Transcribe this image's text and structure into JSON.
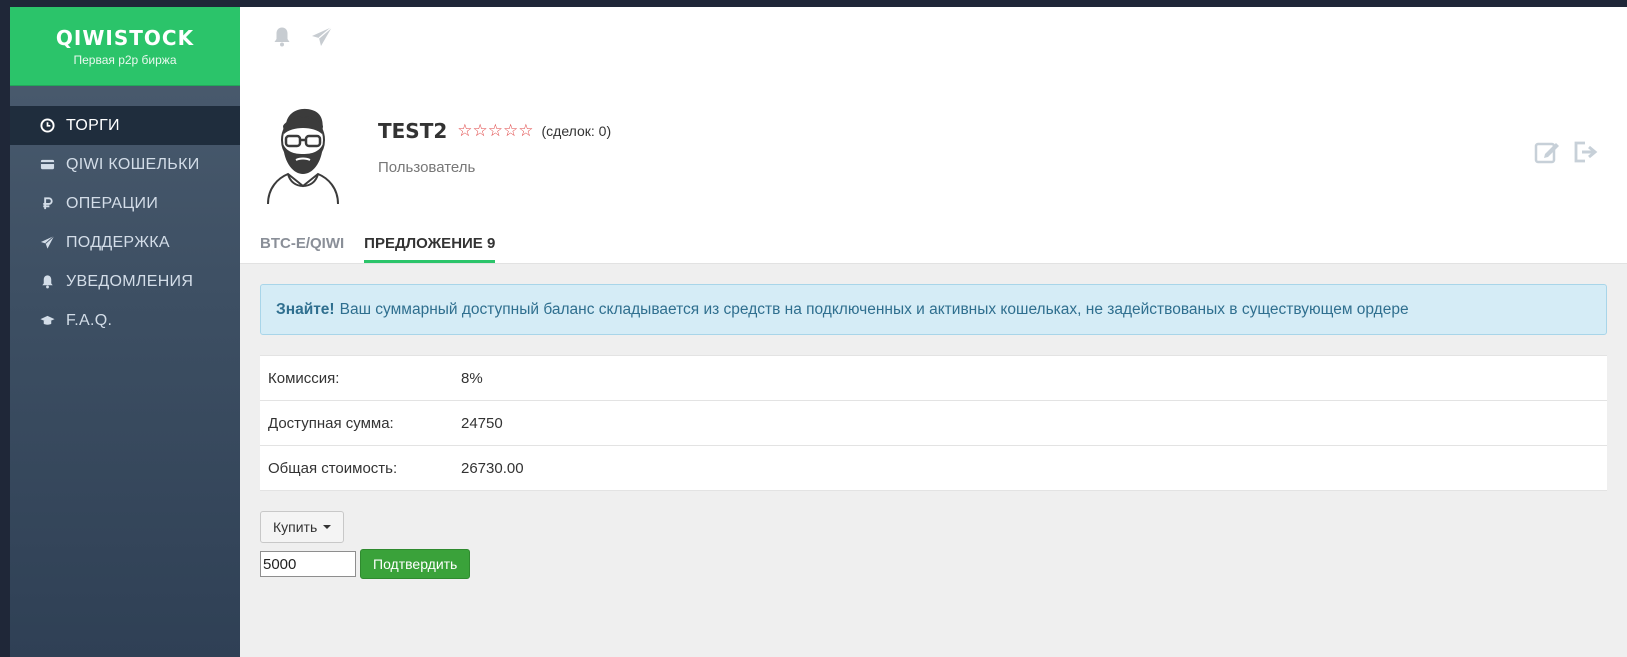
{
  "brand": {
    "title": "QIWISTOCK",
    "subtitle": "Первая p2p биржа",
    "color": "#2bc46a"
  },
  "sidebar": {
    "items": [
      {
        "label": "ТОРГИ",
        "icon": "clock-icon",
        "active": true
      },
      {
        "label": "QIWI КОШЕЛЬКИ",
        "icon": "card-icon"
      },
      {
        "label": "ОПЕРАЦИИ",
        "icon": "ruble-icon"
      },
      {
        "label": "ПОДДЕРЖКА",
        "icon": "paper-plane-icon"
      },
      {
        "label": "УВЕДОМЛЕНИЯ",
        "icon": "bell-icon"
      },
      {
        "label": "F.A.Q.",
        "icon": "graduation-cap-icon"
      }
    ]
  },
  "topbar": {
    "icons": [
      "bell-icon",
      "paper-plane-icon"
    ]
  },
  "profile": {
    "username": "TEST2",
    "stars": "☆☆☆☆☆",
    "deals": "(сделок: 0)",
    "role": "Пользователь",
    "actions": [
      "edit-icon",
      "logout-icon"
    ]
  },
  "tabs": [
    {
      "label": "BTC-E/QIWI",
      "active": false
    },
    {
      "label": "ПРЕДЛОЖЕНИЕ 9",
      "active": true
    }
  ],
  "alert": {
    "strong": "Знайте!",
    "text": "Ваш суммарный доступный баланс складывается из средств на подключенных и активных кошельках, не задействованых в существующем ордере"
  },
  "info": [
    {
      "key": "Комиссия:",
      "value": "8%"
    },
    {
      "key": "Доступная сумма:",
      "value": "24750"
    },
    {
      "key": "Общая стоимость:",
      "value": "26730.00"
    }
  ],
  "order": {
    "buy_label": "Купить",
    "amount": "5000",
    "confirm_label": "Подтвердить"
  }
}
